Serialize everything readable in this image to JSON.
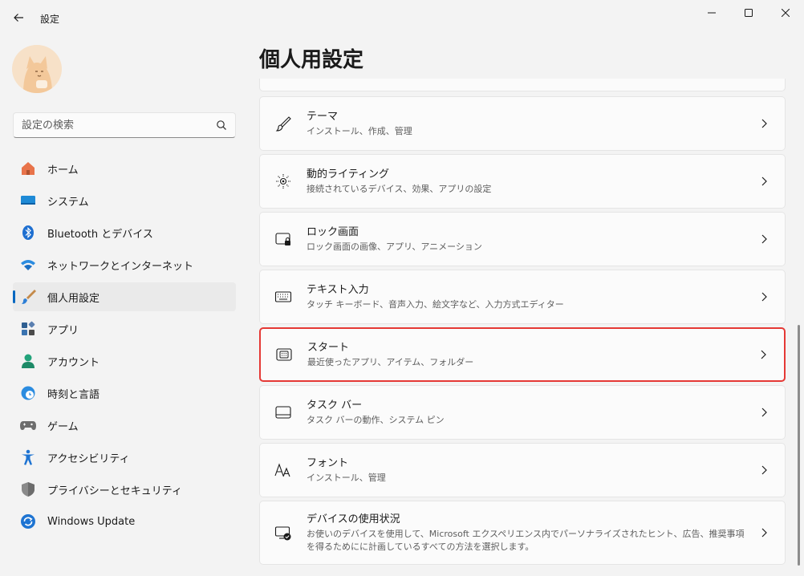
{
  "window": {
    "title": "設定",
    "back_icon": "back-arrow-icon",
    "minimize_icon": "minimize-icon",
    "maximize_icon": "maximize-icon",
    "close_icon": "close-icon"
  },
  "search": {
    "placeholder": "設定の検索",
    "icon": "search-icon"
  },
  "sidebar": {
    "items": [
      {
        "label": "ホーム",
        "icon": "home-icon"
      },
      {
        "label": "システム",
        "icon": "system-icon"
      },
      {
        "label": "Bluetooth とデバイス",
        "icon": "bluetooth-icon"
      },
      {
        "label": "ネットワークとインターネット",
        "icon": "wifi-icon"
      },
      {
        "label": "個人用設定",
        "icon": "brush-icon",
        "active": true
      },
      {
        "label": "アプリ",
        "icon": "apps-icon"
      },
      {
        "label": "アカウント",
        "icon": "account-icon"
      },
      {
        "label": "時刻と言語",
        "icon": "time-language-icon"
      },
      {
        "label": "ゲーム",
        "icon": "gaming-icon"
      },
      {
        "label": "アクセシビリティ",
        "icon": "accessibility-icon"
      },
      {
        "label": "プライバシーとセキュリティ",
        "icon": "shield-icon"
      },
      {
        "label": "Windows Update",
        "icon": "windows-update-icon"
      }
    ]
  },
  "main": {
    "title": "個人用設定",
    "cards": [
      {
        "title": "テーマ",
        "subtitle": "インストール、作成、管理",
        "icon": "brush-icon"
      },
      {
        "title": "動的ライティング",
        "subtitle": "接続されているデバイス、効果、アプリの設定",
        "icon": "dynamic-lighting-icon"
      },
      {
        "title": "ロック画面",
        "subtitle": "ロック画面の画像、アプリ、アニメーション",
        "icon": "lock-screen-icon"
      },
      {
        "title": "テキスト入力",
        "subtitle": "タッチ キーボード、音声入力、絵文字など、入力方式エディター",
        "icon": "keyboard-icon"
      },
      {
        "title": "スタート",
        "subtitle": "最近使ったアプリ、アイテム、フォルダー",
        "icon": "start-icon",
        "highlighted": true
      },
      {
        "title": "タスク バー",
        "subtitle": "タスク バーの動作、システム ピン",
        "icon": "taskbar-icon"
      },
      {
        "title": "フォント",
        "subtitle": "インストール、管理",
        "icon": "font-icon"
      },
      {
        "title": "デバイスの使用状況",
        "subtitle": "お使いのデバイスを使用して、Microsoft エクスペリエンス内でパーソナライズされたヒント、広告、推奨事項を得るためにに計画しているすべての方法を選択します。",
        "icon": "device-usage-icon"
      }
    ]
  },
  "colors": {
    "accent": "#0067c0",
    "highlight_border": "#e53935",
    "background": "#f3f3f3",
    "card": "#fbfbfb"
  }
}
